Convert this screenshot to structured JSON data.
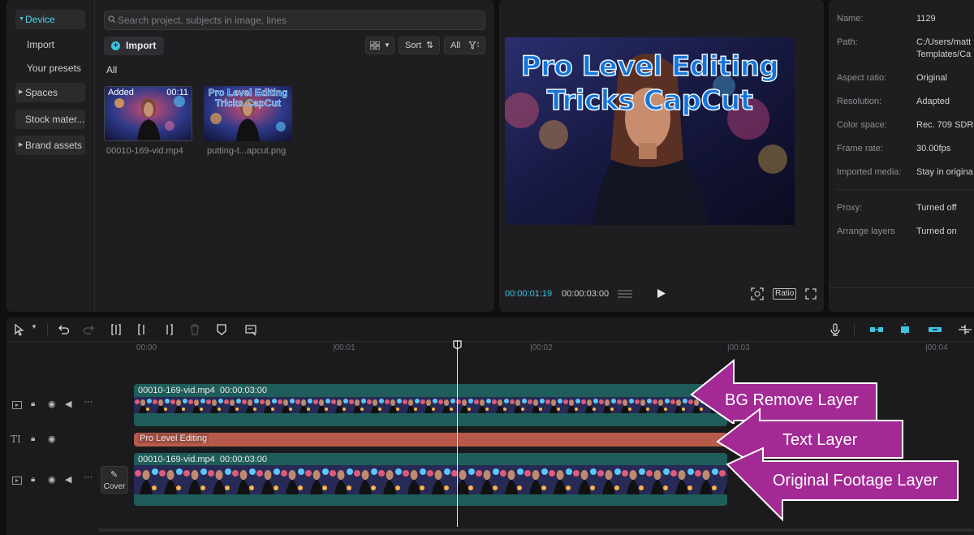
{
  "media": {
    "sidebar": {
      "device": "Device",
      "import": "Import",
      "presets": "Your presets",
      "spaces": "Spaces",
      "stock": "Stock mater...",
      "brand": "Brand assets"
    },
    "search_placeholder": "Search project, subjects in image, lines",
    "import_label": "Import",
    "sort_label": "Sort",
    "filter_label": "All",
    "all_label": "All",
    "items": [
      {
        "name": "00010-169-vid.mp4",
        "badge": "Added",
        "duration": "00:11"
      },
      {
        "name": "putting-t...apcut.png",
        "overlay_text": "Pro Level Editing Tricks CapCut"
      }
    ]
  },
  "player": {
    "title_line1": "Pro Level Editing",
    "title_line2": "Tricks CapCut",
    "current_time": "00:00:01:19",
    "total_time": "00:00:03:00",
    "ratio_label": "Ratio"
  },
  "details": {
    "rows": [
      {
        "label": "Name:",
        "value": "1129"
      },
      {
        "label": "Path:",
        "value": "C:/Users/matt",
        "value2": "Templates/Ca"
      },
      {
        "label": "Aspect ratio:",
        "value": "Original"
      },
      {
        "label": "Resolution:",
        "value": "Adapted"
      },
      {
        "label": "Color space:",
        "value": "Rec. 709 SDR"
      },
      {
        "label": "Frame rate:",
        "value": "30.00fps"
      },
      {
        "label": "Imported media:",
        "value": "Stay in origina"
      },
      {
        "label": "Proxy:",
        "value": "Turned off"
      },
      {
        "label": "Arrange layers",
        "value": "Turned on"
      }
    ]
  },
  "timeline": {
    "ruler": [
      "00:00",
      "00:01",
      "00:02",
      "00:03",
      "00:04"
    ],
    "clips": {
      "top_name": "00010-169-vid.mp4",
      "top_duration": "00:00:03:00",
      "text_clip": "Pro Level Editing",
      "main_name": "00010-169-vid.mp4",
      "main_duration": "00:00:03:00"
    },
    "cover_label": "Cover",
    "text_track_icon": "TI",
    "playhead_fraction": 0.33
  },
  "callouts": {
    "bg_remove": "BG Remove Layer",
    "text_layer": "Text Layer",
    "original": "Original Footage Layer"
  },
  "colors": {
    "accent": "#3ec3e0",
    "clip_teal": "#1f5d5b",
    "text_clip": "#b85a4a",
    "callout": "#a32a95"
  }
}
